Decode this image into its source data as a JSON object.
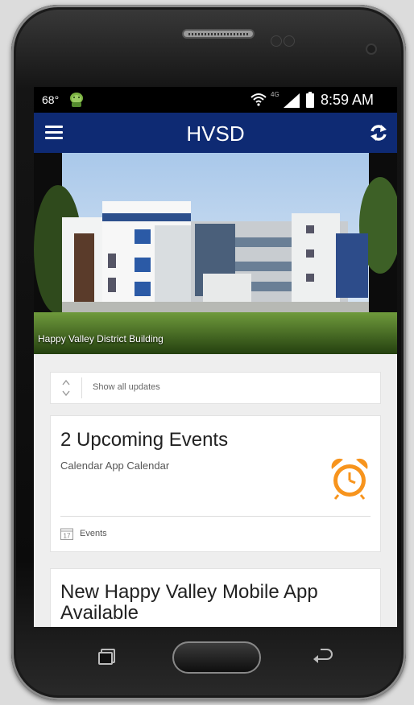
{
  "status_bar": {
    "temperature": "68°",
    "network": "4G",
    "time": "8:59 AM"
  },
  "app_bar": {
    "title": "HVSD",
    "menu_icon": "hamburger-menu-icon",
    "refresh_icon": "refresh-icon"
  },
  "hero": {
    "caption": "Happy Valley District Building"
  },
  "updates": {
    "label": "Show all updates"
  },
  "event_card": {
    "title": "2 Upcoming Events",
    "subtitle": "Calendar App Calendar",
    "link_label": "Events",
    "calendar_icon_text": "17",
    "alarm_color": "#f7941d"
  },
  "news_card": {
    "title": "New Happy Valley Mobile App Available"
  },
  "colors": {
    "app_bar": "#0e2a73",
    "background": "#eeeeee",
    "accent": "#f7941d"
  }
}
